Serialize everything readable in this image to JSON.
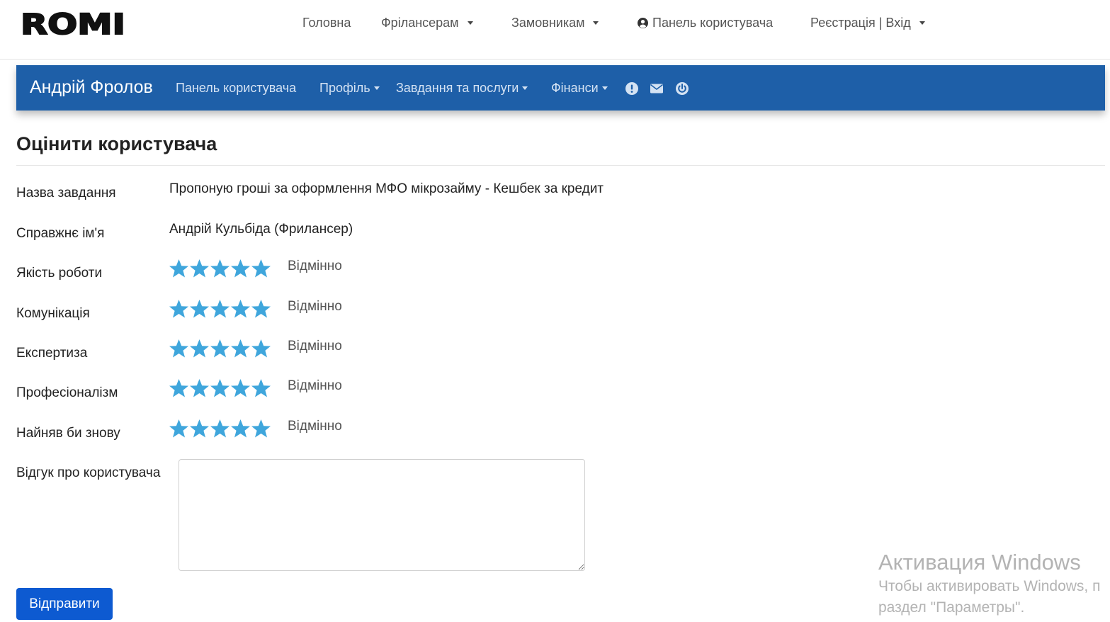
{
  "header": {
    "logo_text": "ROMI",
    "nav": {
      "home": "Головна",
      "freelancers": "Фріланcерам",
      "customers": "Замовникам",
      "dashboard": "Панель користувача",
      "auth": "Реєстрація | Вхід"
    }
  },
  "userbar": {
    "user_name": "Андрій Фролов",
    "dashboard": "Панель користувача",
    "profile": "Профіль",
    "tasks": "Завдання та послуги",
    "finance": "Фінанси",
    "icons": [
      "info-icon",
      "envelope-icon",
      "power-icon"
    ]
  },
  "page": {
    "title": "Оцінити користувача",
    "task_label": "Назва завдання",
    "task_value": "Пропоную гроші за оформлення МФО мікрозайму - Кешбек за кредит",
    "name_label": "Справжнє ім'я",
    "name_value": "Андрій Кульбіда (Фрилансер)",
    "ratings": [
      {
        "label": "Якість роботи",
        "stars": 5,
        "text": "Відмінно"
      },
      {
        "label": "Комунікація",
        "stars": 5,
        "text": "Відмінно"
      },
      {
        "label": "Експертиза",
        "stars": 5,
        "text": "Відмінно"
      },
      {
        "label": "Професіоналізм",
        "stars": 5,
        "text": "Відмінно"
      },
      {
        "label": "Найняв би знову",
        "stars": 5,
        "text": "Відмінно"
      }
    ],
    "review_label": "Відгук про користувача",
    "review_value": "",
    "submit_label": "Відправити"
  },
  "watermark": {
    "line1": "Активация Windows",
    "line2": "Чтобы активировать Windows, п",
    "line3": "раздел \"Параметры\"."
  },
  "colors": {
    "accent_bar": "#1e5fa8",
    "star": "#3fa6dc",
    "button": "#0d5ad1"
  }
}
